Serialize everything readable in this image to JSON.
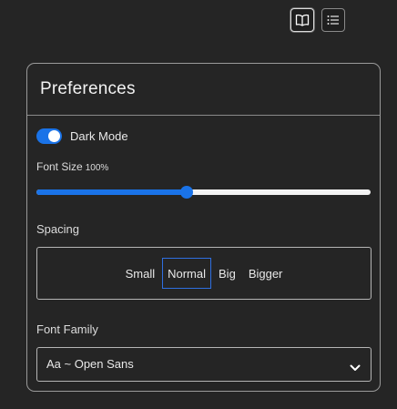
{
  "toolbar": {
    "book_view_icon": "open-book-icon",
    "list_view_icon": "list-icon"
  },
  "preferences": {
    "title": "Preferences",
    "dark_mode": {
      "label": "Dark Mode",
      "enabled": true
    },
    "font_size": {
      "label": "Font Size",
      "value_text": "100%",
      "slider_fraction": 0.45
    },
    "spacing": {
      "label": "Spacing",
      "options": [
        "Small",
        "Normal",
        "Big",
        "Bigger"
      ],
      "selected": "Normal"
    },
    "font_family": {
      "label": "Font Family",
      "selected": "Aa ~ Open Sans"
    }
  },
  "colors": {
    "background": "#252525",
    "accent": "#1a73e8",
    "border": "#9a9a9a"
  }
}
